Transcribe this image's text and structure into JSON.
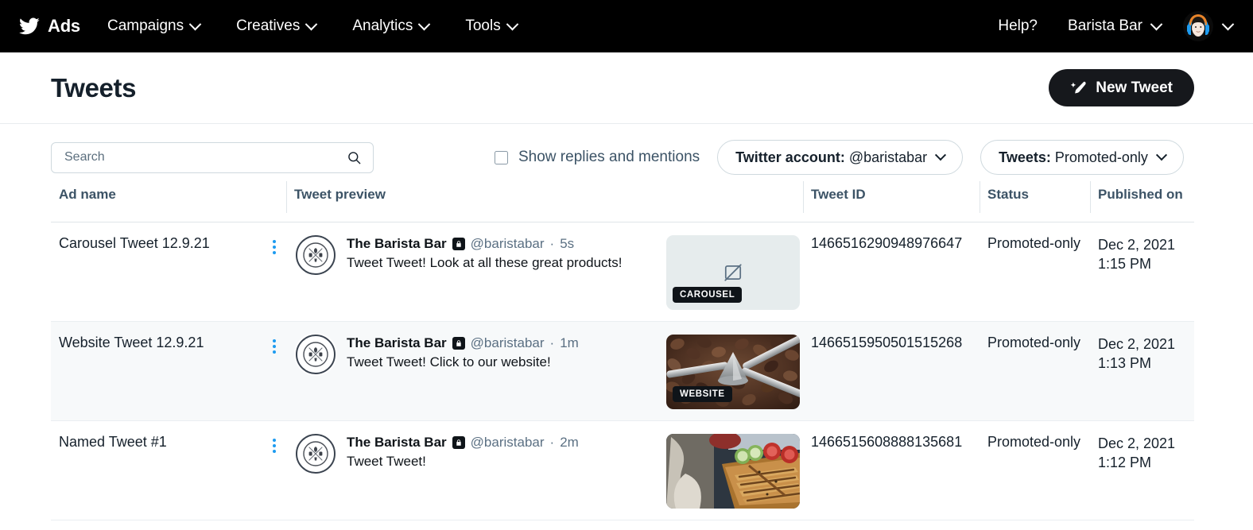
{
  "topnav": {
    "brand_icon": "twitter-bird-icon",
    "brand_label": "Ads",
    "items": [
      {
        "label": "Campaigns",
        "icon": "chevron-down-icon"
      },
      {
        "label": "Creatives",
        "icon": "chevron-down-icon"
      },
      {
        "label": "Analytics",
        "icon": "chevron-down-icon"
      },
      {
        "label": "Tools",
        "icon": "chevron-down-icon"
      }
    ],
    "help_label": "Help?",
    "account_label": "Barista Bar",
    "account_chevron": "chevron-down-icon",
    "avatar_icon": "user-avatar-headphones",
    "avatar_chevron": "chevron-down-icon"
  },
  "header": {
    "title": "Tweets",
    "new_tweet_label": "New Tweet",
    "new_tweet_icon": "feather-compose-icon"
  },
  "filters": {
    "search": {
      "placeholder": "Search",
      "value": "",
      "icon": "search-icon"
    },
    "checkbox": {
      "label": "Show replies and mentions",
      "checked": false
    },
    "account_filter": {
      "prefix": "Twitter account:",
      "value": "@baristabar",
      "icon": "chevron-down-icon"
    },
    "tweets_filter": {
      "prefix": "Tweets:",
      "value": "Promoted-only",
      "icon": "chevron-down-icon"
    }
  },
  "table": {
    "columns": [
      "Ad name",
      "Tweet preview",
      "Tweet ID",
      "Status",
      "Published on"
    ],
    "rows": [
      {
        "ad_name": "Carousel Tweet 12.9.21",
        "menu_icon": "kebab-menu-icon",
        "avatar_icon": "barista-bar-logo",
        "display_name": "The Barista Bar",
        "lock_icon": "protected-lock-icon",
        "handle": "@baristabar",
        "separator": "·",
        "age": "5s",
        "tweet_text": "Tweet Tweet! Look at all these great products!",
        "thumb_badge": "CAROUSEL",
        "thumb_kind": "broken-image",
        "thumb_icon": "image-unavailable-icon",
        "tweet_id": "1466516290948976647",
        "status": "Promoted-only",
        "published_date": "Dec 2, 2021",
        "published_time": "1:15 PM"
      },
      {
        "ad_name": "Website Tweet 12.9.21",
        "menu_icon": "kebab-menu-icon",
        "avatar_icon": "barista-bar-logo",
        "display_name": "The Barista Bar",
        "lock_icon": "protected-lock-icon",
        "handle": "@baristabar",
        "separator": "·",
        "age": "1m",
        "tweet_text": "Tweet Tweet! Click to our website!",
        "thumb_badge": "WEBSITE",
        "thumb_kind": "coffee-beans-grinder",
        "thumb_icon": "",
        "tweet_id": "1466515950501515268",
        "status": "Promoted-only",
        "published_date": "Dec 2, 2021",
        "published_time": "1:13 PM"
      },
      {
        "ad_name": "Named Tweet #1",
        "menu_icon": "kebab-menu-icon",
        "avatar_icon": "barista-bar-logo",
        "display_name": "The Barista Bar",
        "lock_icon": "protected-lock-icon",
        "handle": "@baristabar",
        "separator": "·",
        "age": "2m",
        "tweet_text": "Tweet Tweet!",
        "thumb_badge": "",
        "thumb_kind": "panini-sandwich",
        "thumb_icon": "",
        "tweet_id": "1466515608888135681",
        "status": "Promoted-only",
        "published_date": "Dec 2, 2021",
        "published_time": "1:12 PM"
      }
    ]
  },
  "colors": {
    "nav_background": "#000000",
    "accent_blue": "#1D9BF0",
    "text_primary": "#15202B",
    "text_muted": "#5B7083",
    "button_dark": "#16181C",
    "row_alt": "#F7F9FA",
    "border": "#CFD9DE"
  }
}
